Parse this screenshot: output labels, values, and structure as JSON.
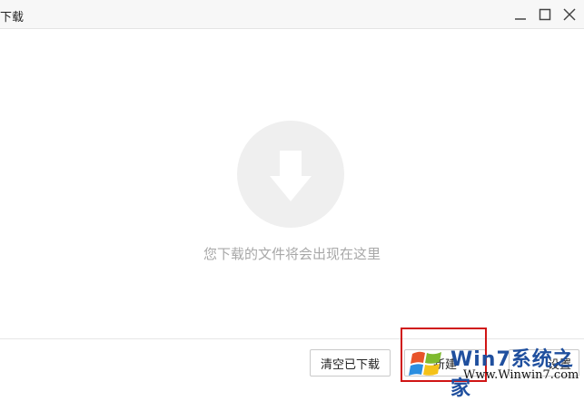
{
  "window": {
    "title": "下载",
    "controls": [
      "minimize-icon",
      "maximize-icon",
      "close-icon"
    ]
  },
  "content": {
    "empty_icon": "download-arrow-icon",
    "empty_message": "您下载的文件将会出现在这里"
  },
  "footer": {
    "clear_label": "清空已下载",
    "new_label": "新建",
    "settings_label": "设置"
  },
  "watermark": {
    "brand": "Win7系统之家",
    "url": "Www.Winwin7.com"
  },
  "colors": {
    "highlight": "#d01515",
    "empty_icon_bg": "#efefef",
    "empty_text": "#a8a8a8"
  }
}
